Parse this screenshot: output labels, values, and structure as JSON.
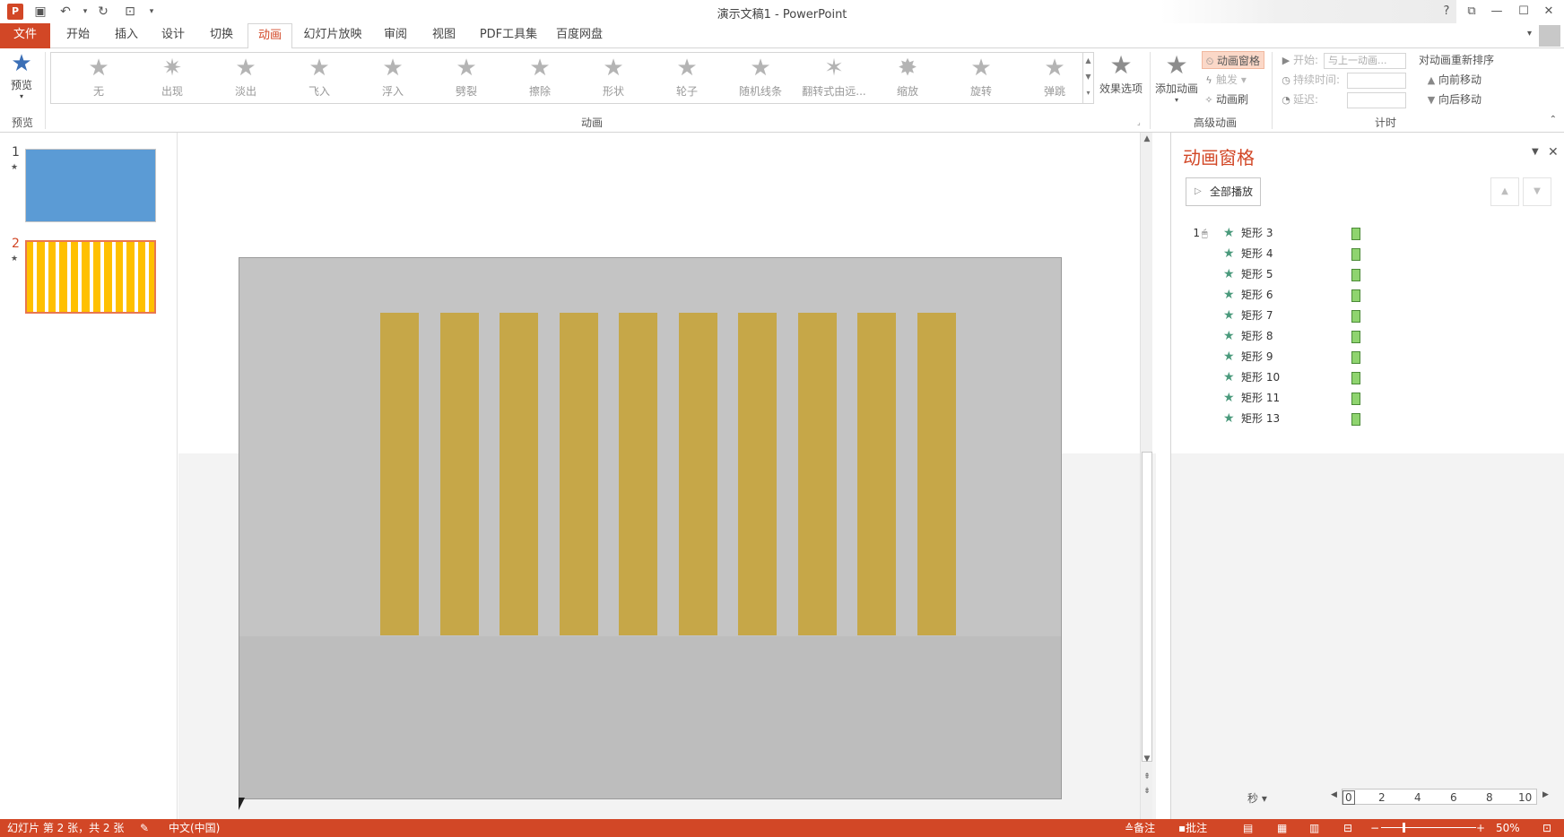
{
  "titlebar": {
    "app_icon": "P",
    "title": "演示文稿1 - PowerPoint",
    "help": "?",
    "qat_icons": [
      "save-icon",
      "undo-icon",
      "redo-icon",
      "present-from-start-icon",
      "customize-icon"
    ]
  },
  "tabs": [
    {
      "label": "文件"
    },
    {
      "label": "开始"
    },
    {
      "label": "插入"
    },
    {
      "label": "设计"
    },
    {
      "label": "切换"
    },
    {
      "label": "动画"
    },
    {
      "label": "幻灯片放映"
    },
    {
      "label": "审阅"
    },
    {
      "label": "视图"
    },
    {
      "label": "PDF工具集"
    },
    {
      "label": "百度网盘"
    }
  ],
  "ribbon": {
    "preview": {
      "button": "预览",
      "group": "预览"
    },
    "animation_gallery": {
      "group": "动画",
      "items": [
        "无",
        "出现",
        "淡出",
        "飞入",
        "浮入",
        "劈裂",
        "擦除",
        "形状",
        "轮子",
        "随机线条",
        "翻转式由远...",
        "缩放",
        "旋转",
        "弹跳"
      ]
    },
    "effect_options": "效果选项",
    "advanced": {
      "group": "高级动画",
      "add_animation": "添加动画",
      "animation_pane": "动画窗格",
      "trigger": "触发",
      "painter": "动画刷"
    },
    "timing": {
      "group": "计时",
      "start_label": "开始:",
      "start_value": "与上一动画...",
      "duration_label": "持续时间:",
      "delay_label": "延迟:",
      "reorder_title": "对动画重新排序",
      "move_earlier": "向前移动",
      "move_later": "向后移动"
    }
  },
  "slides": [
    {
      "number": "1",
      "has_animation": true,
      "background": "#5b9bd5"
    },
    {
      "number": "2",
      "has_animation": true,
      "background": "#ffc000",
      "selected": true
    }
  ],
  "colors": {
    "accent": "#d24726",
    "stripe": "#c6a748",
    "slide_bg": "#c4c4c4",
    "timebar": "#8fd46f"
  },
  "animation_pane": {
    "title": "动画窗格",
    "play_all": "全部播放",
    "items": [
      {
        "num": "1",
        "label": "矩形 3",
        "on_click": true
      },
      {
        "num": "",
        "label": "矩形 4"
      },
      {
        "num": "",
        "label": "矩形 5"
      },
      {
        "num": "",
        "label": "矩形 6"
      },
      {
        "num": "",
        "label": "矩形 7"
      },
      {
        "num": "",
        "label": "矩形 8"
      },
      {
        "num": "",
        "label": "矩形 9"
      },
      {
        "num": "",
        "label": "矩形 10"
      },
      {
        "num": "",
        "label": "矩形 11"
      },
      {
        "num": "",
        "label": "矩形 13"
      }
    ],
    "timeline": {
      "unit": "秒",
      "ticks": [
        "0",
        "2",
        "4",
        "6",
        "8",
        "10"
      ]
    }
  },
  "status": {
    "slide_info": "幻灯片 第 2 张，共 2 张",
    "language": "中文(中国)",
    "notes": "备注",
    "comments": "批注",
    "zoom": "50%"
  }
}
